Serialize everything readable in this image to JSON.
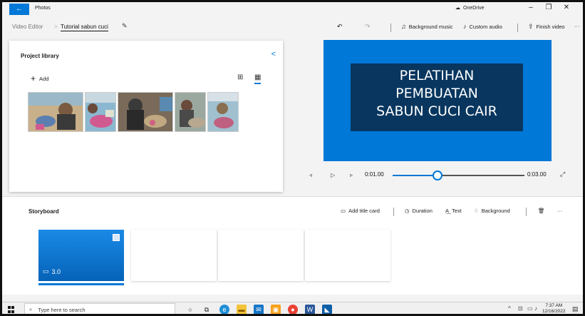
{
  "app": {
    "title": "Photos",
    "back_icon": "back-arrow-icon",
    "onedrive": "OneDrive"
  },
  "window_controls": {
    "minimize": "–",
    "maximize": "❐",
    "close": "✕"
  },
  "breadcrumb": {
    "root": "Video Editor",
    "separator": ">",
    "current": "Tutorial sabun cuci"
  },
  "toolbar": {
    "undo_icon": "↶",
    "redo_icon": "↷",
    "background_music": "Background music",
    "custom_audio": "Custom audio",
    "finish_video": "Finish video",
    "more": "···"
  },
  "library": {
    "title": "Project library",
    "add_label": "Add",
    "add_symbol": "+",
    "collapse_symbol": "<",
    "view_grid": "⊞",
    "view_list": "▦",
    "thumbnails": [
      {
        "name": "photo-1",
        "colors": [
          "#c8b08a",
          "#5a7fb0",
          "#7a5a40"
        ]
      },
      {
        "name": "photo-2",
        "colors": [
          "#8bb8d0",
          "#d05a90",
          "#b0a080"
        ]
      },
      {
        "name": "photo-3",
        "colors": [
          "#7a6a5a",
          "#3a3a3a",
          "#c0a880"
        ]
      },
      {
        "name": "photo-4",
        "colors": [
          "#9aa8a0",
          "#6a4a3a",
          "#b8a890"
        ]
      },
      {
        "name": "photo-5",
        "colors": [
          "#a0c0d0",
          "#c06080",
          "#8a7050"
        ]
      }
    ]
  },
  "preview": {
    "title_lines": [
      "PELATIHAN",
      "PEMBUATAN",
      "SABUN CUCI CAIR"
    ],
    "bg_color": "#0078d7",
    "card_color": "#08365f"
  },
  "playback": {
    "current_time": "0:01.00",
    "end_time": "0:03.00",
    "progress": 0.33,
    "prev": "◃",
    "play": "▷",
    "next": "▹",
    "fullscreen": "⤢"
  },
  "storyboard": {
    "title": "Storyboard",
    "add_title_card": "Add title card",
    "duration": "Duration",
    "text": "Text",
    "background": "Background",
    "more": "···",
    "clips": [
      {
        "duration": "3.0",
        "active": true
      },
      {
        "duration": "",
        "active": false
      },
      {
        "duration": "",
        "active": false
      },
      {
        "duration": "",
        "active": false
      }
    ]
  },
  "taskbar": {
    "search_placeholder": "Type here to search",
    "time": "7:37 AM",
    "date": "12/16/2022"
  }
}
